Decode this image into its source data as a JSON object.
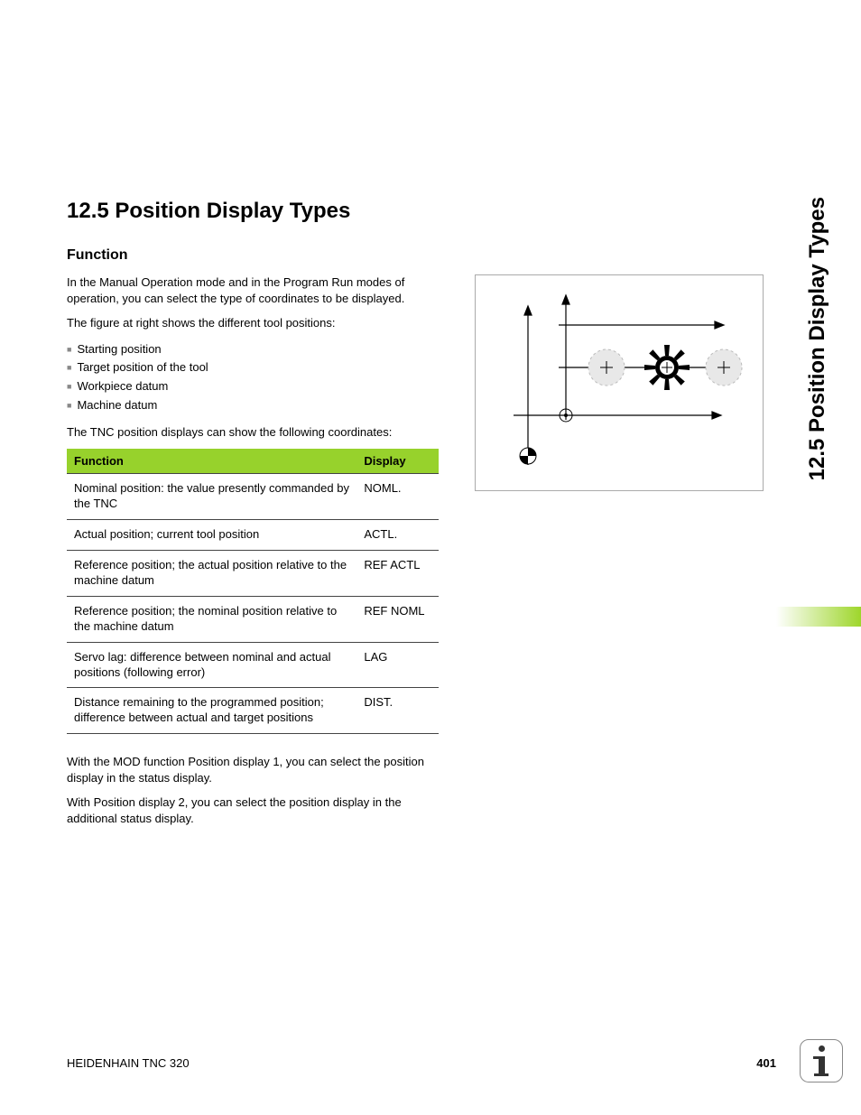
{
  "heading": "12.5 Position Display Types",
  "subheading": "Function",
  "para1": "In the Manual Operation mode and in the Program Run modes of operation, you can select the type of coordinates to be displayed.",
  "para2": "The figure at right shows the different tool positions:",
  "bullets": [
    "Starting position",
    "Target position of the tool",
    "Workpiece datum",
    "Machine datum"
  ],
  "para3": "The TNC position displays can show the following coordinates:",
  "table": {
    "head_func": "Function",
    "head_disp": "Display",
    "rows": [
      {
        "function": "Nominal position: the value presently commanded by the TNC",
        "display": "NOML."
      },
      {
        "function": "Actual position; current tool position",
        "display": "ACTL."
      },
      {
        "function": "Reference position; the actual position relative to the machine datum",
        "display": "REF ACTL"
      },
      {
        "function": "Reference position; the nominal position relative to the machine datum",
        "display": "REF NOML"
      },
      {
        "function": "Servo lag: difference between nominal and actual positions (following error)",
        "display": "LAG"
      },
      {
        "function": "Distance remaining to the programmed position; difference between actual and target positions",
        "display": "DIST."
      }
    ]
  },
  "para4": "With the MOD function Position display 1, you can select the position display in the status display.",
  "para5": "With Position display 2, you can select the position display in the additional status display.",
  "side_title": "12.5 Position Display Types",
  "footer_left": "HEIDENHAIN TNC 320",
  "footer_page": "401"
}
